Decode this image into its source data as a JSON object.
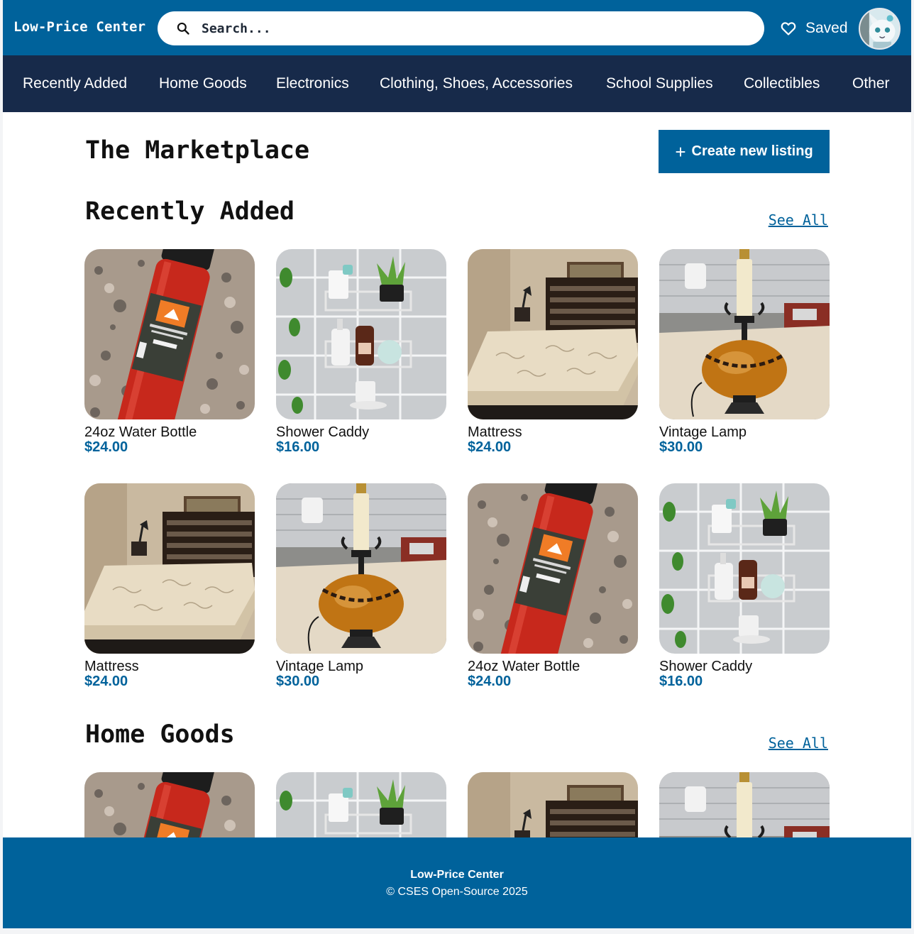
{
  "header": {
    "brand": "Low-Price Center",
    "search_placeholder": "Search...",
    "saved_label": "Saved",
    "colors": {
      "header_bg": "#00629b",
      "nav_bg": "#172a4a",
      "accent": "#00629b"
    }
  },
  "categories": [
    "Recently Added",
    "Home Goods",
    "Electronics",
    "Clothing, Shoes, Accessories",
    "School Supplies",
    "Collectibles",
    "Other"
  ],
  "main": {
    "title": "The Marketplace",
    "create_button_label": "Create new listing"
  },
  "sections": [
    {
      "title": "Recently Added",
      "see_all_label": "See All",
      "items": [
        {
          "title": "24oz Water Bottle",
          "price": "$24.00",
          "image": "water-bottle"
        },
        {
          "title": "Shower Caddy",
          "price": "$16.00",
          "image": "shower-caddy"
        },
        {
          "title": "Mattress",
          "price": "$24.00",
          "image": "mattress"
        },
        {
          "title": "Vintage Lamp",
          "price": "$30.00",
          "image": "vintage-lamp"
        },
        {
          "title": "Mattress",
          "price": "$24.00",
          "image": "mattress"
        },
        {
          "title": "Vintage Lamp",
          "price": "$30.00",
          "image": "vintage-lamp"
        },
        {
          "title": "24oz Water Bottle",
          "price": "$24.00",
          "image": "water-bottle"
        },
        {
          "title": "Shower Caddy",
          "price": "$16.00",
          "image": "shower-caddy"
        }
      ]
    },
    {
      "title": "Home Goods",
      "see_all_label": "See All",
      "items": [
        {
          "image": "water-bottle"
        },
        {
          "image": "shower-caddy"
        },
        {
          "image": "mattress"
        },
        {
          "image": "vintage-lamp"
        }
      ]
    }
  ],
  "footer": {
    "brand": "Low-Price Center",
    "copyright": "© CSES Open-Source 2025"
  }
}
